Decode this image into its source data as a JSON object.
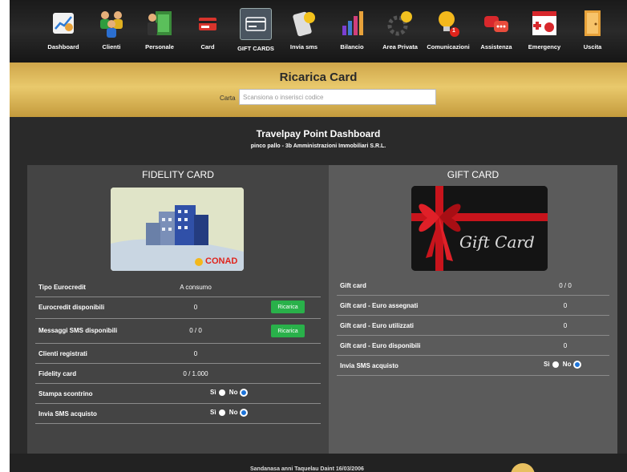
{
  "toolbar": {
    "items": [
      {
        "label": "Dashboard",
        "icon": "dashboard-icon"
      },
      {
        "label": "Clienti",
        "icon": "clients-icon"
      },
      {
        "label": "Personale",
        "icon": "staff-icon"
      },
      {
        "label": "Card",
        "icon": "card-icon"
      },
      {
        "label": "GIFT CARDS",
        "icon": "gift-cards-icon"
      },
      {
        "label": "Invia sms",
        "icon": "sms-icon"
      },
      {
        "label": "Bilancio",
        "icon": "balance-icon"
      },
      {
        "label": "Area Privata",
        "icon": "private-area-icon"
      },
      {
        "label": "Comunicazioni",
        "icon": "communications-icon",
        "badge": "1"
      },
      {
        "label": "Assistenza",
        "icon": "support-icon"
      },
      {
        "label": "Emergency",
        "icon": "emergency-icon"
      },
      {
        "label": "Uscita",
        "icon": "exit-icon"
      }
    ]
  },
  "banner": {
    "title": "Ricarica Card",
    "card_label": "Carta",
    "card_placeholder": "Scansiona o inserisci codice",
    "card_value": ""
  },
  "header": {
    "title": "Travelpay Point Dashboard",
    "subtitle": "pinco pallo - 3b Amministrazioni Immobiliari S.R.L."
  },
  "fidelity": {
    "title": "FIDELITY CARD",
    "logo_text": "CONAD",
    "rows": [
      {
        "key": "Tipo Eurocredit",
        "value": "A consumo"
      },
      {
        "key": "Eurocredit disponibili",
        "value": "0",
        "button": "Ricarica"
      },
      {
        "key": "Messaggi SMS disponibili",
        "value": "0 / 0",
        "button": "Ricarica"
      },
      {
        "key": "Clienti registrati",
        "value": "0"
      },
      {
        "key": "Fidelity card",
        "value": "0 / 1.000"
      }
    ],
    "radios": [
      {
        "key": "Stampa scontrino",
        "yes": "Sì",
        "no": "No",
        "selected": "No"
      },
      {
        "key": "Invia SMS acquisto",
        "yes": "Sì",
        "no": "No",
        "selected": "No"
      }
    ]
  },
  "gift": {
    "title": "GIFT CARD",
    "image_text": "Gift Card",
    "rows": [
      {
        "key": "Gift card",
        "value": "0 / 0"
      },
      {
        "key": "Gift card - Euro assegnati",
        "value": "0"
      },
      {
        "key": "Gift card - Euro utilizzati",
        "value": "0"
      },
      {
        "key": "Gift card - Euro disponibili",
        "value": "0"
      }
    ],
    "radios": [
      {
        "key": "Invia SMS acquisto",
        "yes": "Sì",
        "no": "No",
        "selected": "No"
      }
    ]
  },
  "footer": {
    "text": "Sandanasa anni Taquelau Daint 16/03/2006"
  },
  "colors": {
    "banner_gold": "#e0bc60",
    "button_green": "#29b14a",
    "radio_blue": "#1e74d8",
    "left_panel": "#444444",
    "right_panel": "#5b5b5b"
  }
}
